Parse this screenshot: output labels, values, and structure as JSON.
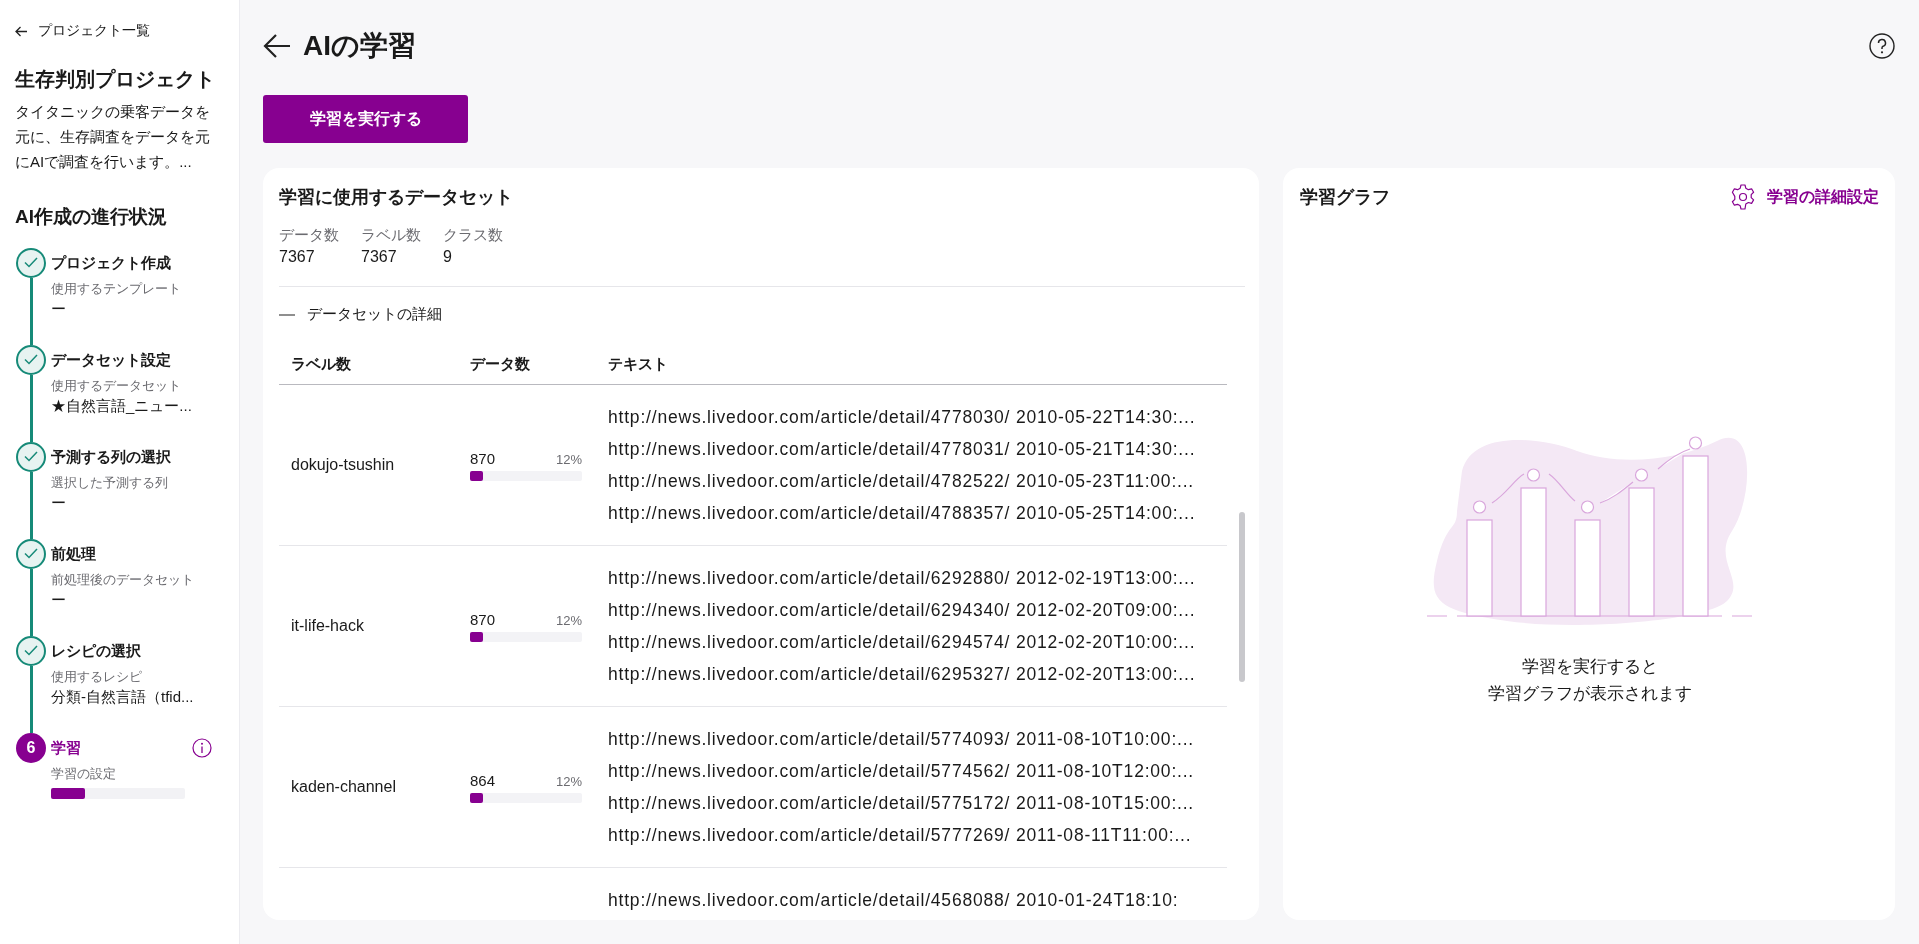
{
  "header": {
    "title": "AIの学習",
    "run_button": "学習を実行する"
  },
  "sidebar": {
    "back_link": "プロジェクト一覧",
    "project_title": "生存判別プロジェクト",
    "project_description": "タイタニックの乗客データを元に、生存調査をデータを元にAIで調査を行います。...",
    "progress_heading": "AI作成の進行状況",
    "steps": [
      {
        "kind": "done",
        "title": "プロジェクト作成",
        "caption": "使用するテンプレート",
        "value": "ー"
      },
      {
        "kind": "done",
        "title": "データセット設定",
        "caption": "使用するデータセット",
        "value": "★自然言語_ニュー..."
      },
      {
        "kind": "done",
        "title": "予測する列の選択",
        "caption": "選択した予測する列",
        "value": "ー"
      },
      {
        "kind": "done",
        "title": "前処理",
        "caption": "前処理後のデータセット",
        "value": "ー"
      },
      {
        "kind": "done",
        "title": "レシピの選択",
        "caption": "使用するレシピ",
        "value": "分類-自然言語（tfid..."
      },
      {
        "kind": "current",
        "number": "6",
        "title": "学習",
        "caption": "学習の設定",
        "level": 0.25
      }
    ]
  },
  "dataset_card": {
    "title": "学習に使用するデータセット",
    "stats": [
      {
        "label": "データ数",
        "value": "7367"
      },
      {
        "label": "ラベル数",
        "value": "7367"
      },
      {
        "label": "クラス数",
        "value": "9"
      }
    ],
    "details_toggle": {
      "label": "データセットの詳細",
      "expanded": true
    },
    "table": {
      "columns": [
        "ラベル数",
        "データ数",
        "テキスト"
      ],
      "rows": [
        {
          "label": "dokujo-tsushin",
          "count": "870",
          "percent": "12%",
          "level": 0.12,
          "texts": [
            "http://news.livedoor.com/article/detail/4778030/ 2010-05-22T14:30:...",
            "http://news.livedoor.com/article/detail/4778031/ 2010-05-21T14:30:...",
            "http://news.livedoor.com/article/detail/4782522/ 2010-05-23T11:00:...",
            "http://news.livedoor.com/article/detail/4788357/ 2010-05-25T14:00:..."
          ]
        },
        {
          "label": "it-life-hack",
          "count": "870",
          "percent": "12%",
          "level": 0.12,
          "texts": [
            "http://news.livedoor.com/article/detail/6292880/ 2012-02-19T13:00:...",
            "http://news.livedoor.com/article/detail/6294340/ 2012-02-20T09:00:...",
            "http://news.livedoor.com/article/detail/6294574/ 2012-02-20T10:00:...",
            "http://news.livedoor.com/article/detail/6295327/ 2012-02-20T13:00:..."
          ]
        },
        {
          "label": "kaden-channel",
          "count": "864",
          "percent": "12%",
          "level": 0.12,
          "texts": [
            "http://news.livedoor.com/article/detail/5774093/ 2011-08-10T10:00:...",
            "http://news.livedoor.com/article/detail/5774562/ 2011-08-10T12:00:...",
            "http://news.livedoor.com/article/detail/5775172/ 2011-08-10T15:00:...",
            "http://news.livedoor.com/article/detail/5777269/ 2011-08-11T11:00:..."
          ]
        },
        {
          "texts": [
            "http://news.livedoor.com/article/detail/4568088/ 2010-01-24T18:10:"
          ]
        }
      ]
    }
  },
  "graph_card": {
    "title": "学習グラフ",
    "settings_link": "学習の詳細設定",
    "empty_message": [
      "学習を実行すると",
      "学習グラフが表示されます"
    ]
  }
}
